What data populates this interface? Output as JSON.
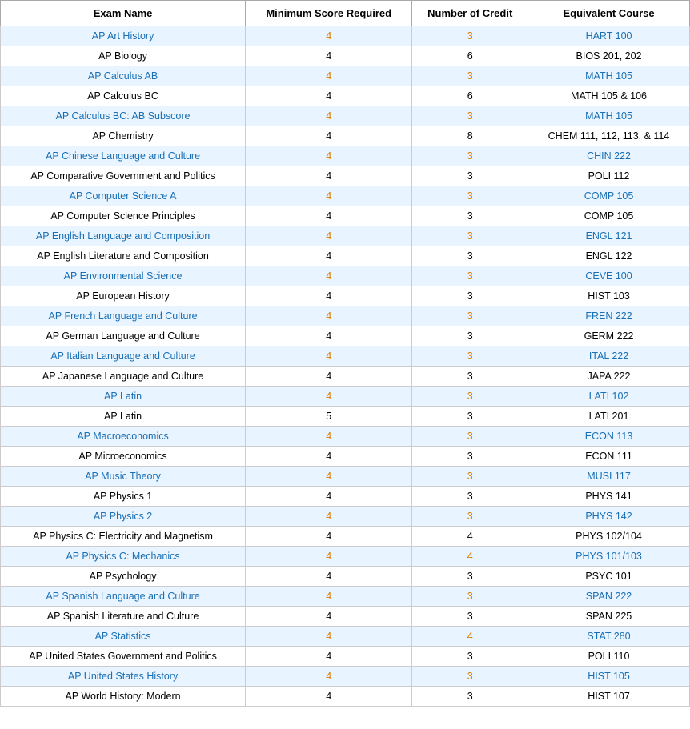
{
  "table": {
    "headers": [
      "Exam Name",
      "Minimum Score Required",
      "Number of Credit",
      "Equivalent Course"
    ],
    "rows": [
      {
        "name": "AP Art History",
        "score": "4",
        "credits": "3",
        "course": "HART 100",
        "highlighted": true
      },
      {
        "name": "AP Biology",
        "score": "4",
        "credits": "6",
        "course": "BIOS 201, 202",
        "highlighted": false
      },
      {
        "name": "AP Calculus AB",
        "score": "4",
        "credits": "3",
        "course": "MATH 105",
        "highlighted": true
      },
      {
        "name": "AP Calculus BC",
        "score": "4",
        "credits": "6",
        "course": "MATH 105 & 106",
        "highlighted": false
      },
      {
        "name": "AP Calculus BC: AB Subscore",
        "score": "4",
        "credits": "3",
        "course": "MATH 105",
        "highlighted": true
      },
      {
        "name": "AP Chemistry",
        "score": "4",
        "credits": "8",
        "course": "CHEM 111, 112, 113, & 114",
        "highlighted": false
      },
      {
        "name": "AP Chinese Language and Culture",
        "score": "4",
        "credits": "3",
        "course": "CHIN 222",
        "highlighted": true
      },
      {
        "name": "AP Comparative Government and Politics",
        "score": "4",
        "credits": "3",
        "course": "POLI 112",
        "highlighted": false
      },
      {
        "name": "AP Computer Science A",
        "score": "4",
        "credits": "3",
        "course": "COMP 105",
        "highlighted": true
      },
      {
        "name": "AP Computer Science Principles",
        "score": "4",
        "credits": "3",
        "course": "COMP 105",
        "highlighted": false
      },
      {
        "name": "AP English Language and Composition",
        "score": "4",
        "credits": "3",
        "course": "ENGL 121",
        "highlighted": true
      },
      {
        "name": "AP English Literature and Composition",
        "score": "4",
        "credits": "3",
        "course": "ENGL 122",
        "highlighted": false
      },
      {
        "name": "AP Environmental Science",
        "score": "4",
        "credits": "3",
        "course": "CEVE 100",
        "highlighted": true
      },
      {
        "name": "AP European History",
        "score": "4",
        "credits": "3",
        "course": "HIST 103",
        "highlighted": false
      },
      {
        "name": "AP French Language and Culture",
        "score": "4",
        "credits": "3",
        "course": "FREN 222",
        "highlighted": true
      },
      {
        "name": "AP German Language and Culture",
        "score": "4",
        "credits": "3",
        "course": "GERM 222",
        "highlighted": false
      },
      {
        "name": "AP Italian Language and Culture",
        "score": "4",
        "credits": "3",
        "course": "ITAL 222",
        "highlighted": true
      },
      {
        "name": "AP Japanese Language and Culture",
        "score": "4",
        "credits": "3",
        "course": "JAPA 222",
        "highlighted": false
      },
      {
        "name": "AP Latin",
        "score": "4",
        "credits": "3",
        "course": "LATI 102",
        "highlighted": true
      },
      {
        "name": "AP Latin",
        "score": "5",
        "credits": "3",
        "course": "LATI 201",
        "highlighted": false
      },
      {
        "name": "AP Macroeconomics",
        "score": "4",
        "credits": "3",
        "course": "ECON 113",
        "highlighted": true
      },
      {
        "name": "AP Microeconomics",
        "score": "4",
        "credits": "3",
        "course": "ECON 111",
        "highlighted": false
      },
      {
        "name": "AP Music Theory",
        "score": "4",
        "credits": "3",
        "course": "MUSI 117",
        "highlighted": true
      },
      {
        "name": "AP Physics 1",
        "score": "4",
        "credits": "3",
        "course": "PHYS 141",
        "highlighted": false
      },
      {
        "name": "AP Physics 2",
        "score": "4",
        "credits": "3",
        "course": "PHYS 142",
        "highlighted": true
      },
      {
        "name": "AP Physics C: Electricity and Magnetism",
        "score": "4",
        "credits": "4",
        "course": "PHYS 102/104",
        "highlighted": false
      },
      {
        "name": "AP Physics C: Mechanics",
        "score": "4",
        "credits": "4",
        "course": "PHYS 101/103",
        "highlighted": true
      },
      {
        "name": "AP Psychology",
        "score": "4",
        "credits": "3",
        "course": "PSYC 101",
        "highlighted": false
      },
      {
        "name": "AP Spanish Language and Culture",
        "score": "4",
        "credits": "3",
        "course": "SPAN 222",
        "highlighted": true
      },
      {
        "name": "AP Spanish Literature and Culture",
        "score": "4",
        "credits": "3",
        "course": "SPAN 225",
        "highlighted": false
      },
      {
        "name": "AP Statistics",
        "score": "4",
        "credits": "4",
        "course": "STAT 280",
        "highlighted": true
      },
      {
        "name": "AP United States Government and Politics",
        "score": "4",
        "credits": "3",
        "course": "POLI 110",
        "highlighted": false
      },
      {
        "name": "AP United States History",
        "score": "4",
        "credits": "3",
        "course": "HIST 105",
        "highlighted": true
      },
      {
        "name": "AP World History: Modern",
        "score": "4",
        "credits": "3",
        "course": "HIST 107",
        "highlighted": false
      }
    ]
  }
}
